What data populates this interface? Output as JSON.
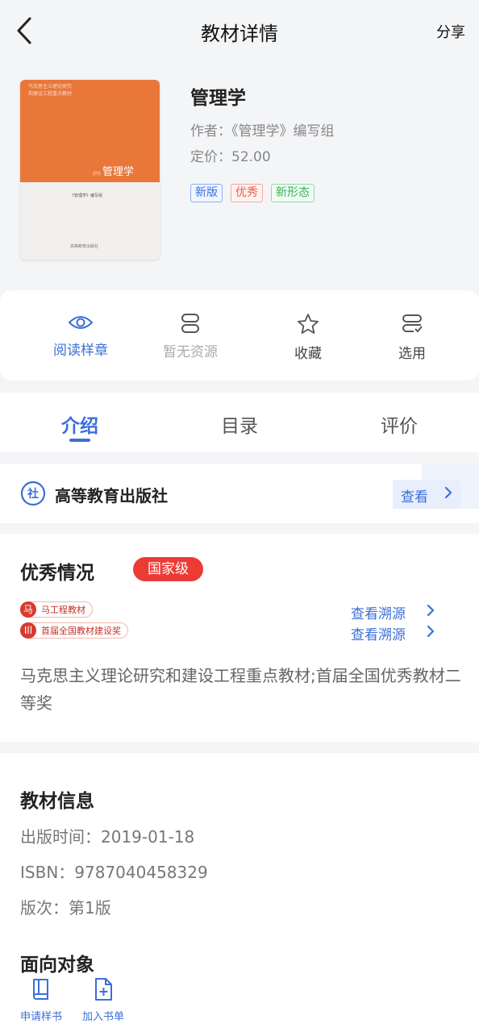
{
  "header": {
    "title": "教材详情",
    "share_label": "分享"
  },
  "book": {
    "title": "管理学",
    "author": "作者：《管理学》编写组",
    "price": "定价：52.00",
    "tags": [
      "新版",
      "优秀",
      "新形态"
    ],
    "cover": {
      "series_lines": [
        "马克思主义理论研究",
        "和建设工程重点教材"
      ],
      "title_small": "研究",
      "title": "管理学",
      "editor": "《管理学》编写组",
      "publisher": "高等教育出版社"
    }
  },
  "actions": [
    {
      "label": "阅读样章",
      "icon": "eye-icon",
      "state": "active"
    },
    {
      "label": "暂无资源",
      "icon": "resource-icon",
      "state": "disabled"
    },
    {
      "label": "收藏",
      "icon": "star-icon",
      "state": "normal"
    },
    {
      "label": "选用",
      "icon": "select-icon",
      "state": "normal"
    }
  ],
  "tabs": {
    "items": [
      "介绍",
      "目录",
      "评价"
    ],
    "active": "介绍"
  },
  "publisher": {
    "name": "高等教育出版社",
    "view_label": "查看",
    "icon_char": "社"
  },
  "excellence": {
    "title": "优秀情况",
    "level": "国家级",
    "awards": [
      {
        "badge": "马工程教材",
        "icon_char": "马",
        "trace": "查看溯源"
      },
      {
        "badge": "首届全国教材建设奖",
        "icon_char": "Ill",
        "trace": "查看溯源"
      }
    ],
    "description": "马克思主义理论研究和建设工程重点教材;首届全国优秀教材二等奖"
  },
  "info": {
    "title": "教材信息",
    "publish_date": "出版时间：2019-01-18",
    "isbn": "ISBN：9787040458329",
    "edition": "版次：第1版",
    "audience_title": "面向对象"
  },
  "bottom_bar": [
    {
      "label": "申请样书",
      "icon": "book-icon"
    },
    {
      "label": "加入书单",
      "icon": "add-document-icon"
    }
  ],
  "colors": {
    "accent": "#3b6fd8",
    "cover_orange": "#e9773a",
    "level_red": "#ec3b34"
  }
}
